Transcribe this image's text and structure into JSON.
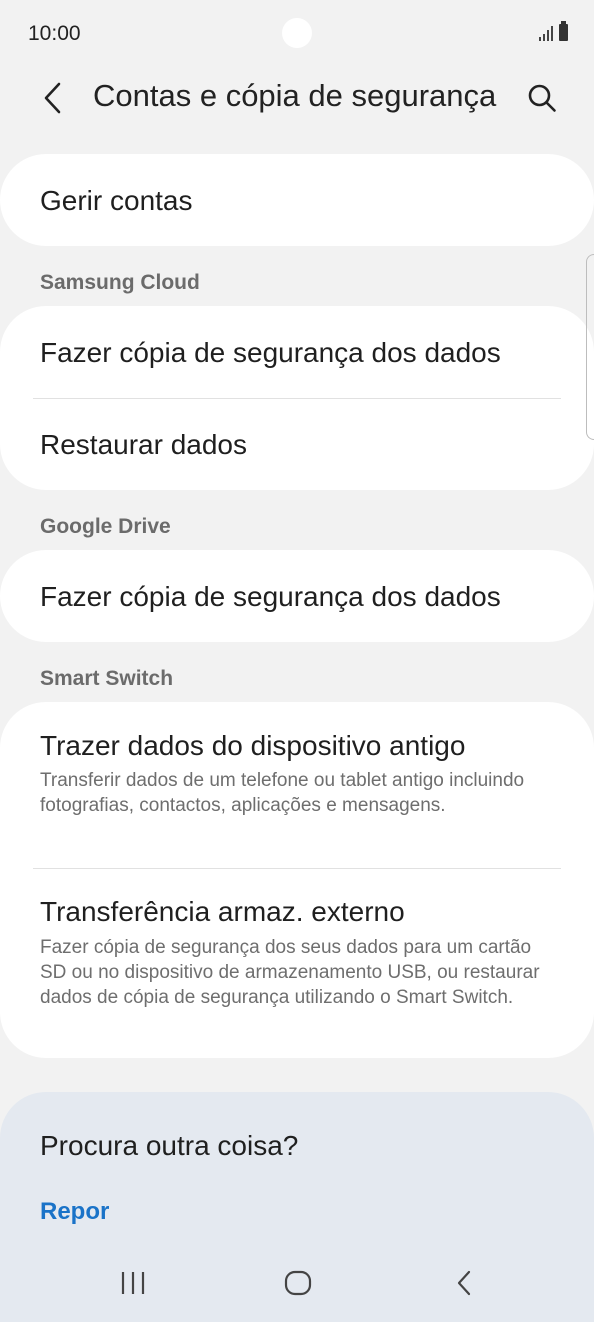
{
  "status_bar": {
    "time": "10:00"
  },
  "header": {
    "title": "Contas e cópia de segurança"
  },
  "sections": {
    "accounts": {
      "item": "Gerir contas"
    },
    "samsung_cloud": {
      "label": "Samsung Cloud",
      "items": [
        "Fazer cópia de segurança dos dados",
        "Restaurar dados"
      ]
    },
    "google_drive": {
      "label": "Google Drive",
      "items": [
        "Fazer cópia de segurança dos dados"
      ]
    },
    "smart_switch": {
      "label": "Smart Switch",
      "items": [
        {
          "title": "Trazer dados do dispositivo antigo",
          "subtitle": "Transferir dados de um telefone ou tablet antigo incluindo fotografias, contactos, aplicações e mensagens."
        },
        {
          "title": "Transferência armaz. externo",
          "subtitle": "Fazer cópia de segurança dos seus dados para um cartão SD ou no dispositivo de armazenamento USB, ou restaurar dados de cópia de segurança utilizando o Smart Switch."
        }
      ]
    }
  },
  "suggestions": {
    "title": "Procura outra coisa?",
    "link": "Repor"
  },
  "colors": {
    "link": "#1a73c8",
    "background": "#f2f2f2",
    "card": "#ffffff",
    "suggest_bg": "#e4e9f0"
  },
  "icons": {
    "back": "chevron-left-icon",
    "search": "search-icon",
    "recents": "recents-icon",
    "home": "home-icon",
    "nav_back": "back-icon"
  }
}
